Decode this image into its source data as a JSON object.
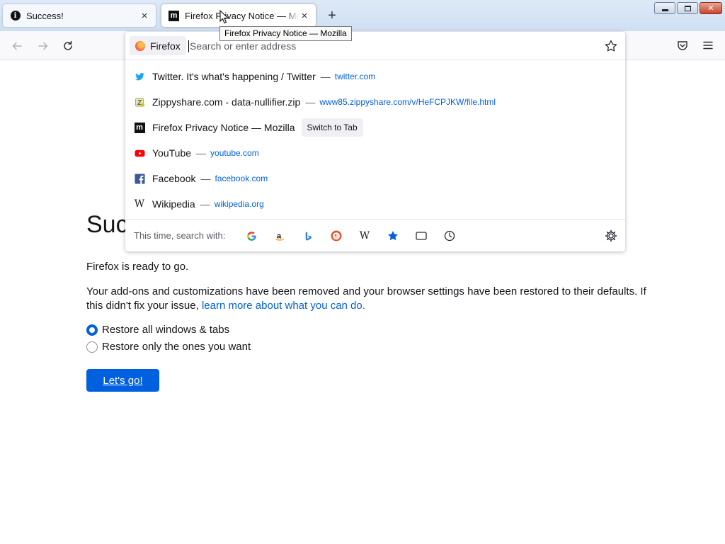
{
  "tabs": [
    {
      "title": "Success!",
      "icon": "info-icon",
      "close_label": "×"
    },
    {
      "title": "Firefox Privacy Notice — Mozilla",
      "icon": "mozilla-m-icon",
      "close_label": "×"
    }
  ],
  "new_tab_label": "+",
  "tooltip": "Firefox Privacy Notice — Mozilla",
  "urlbar": {
    "identity_label": "Firefox",
    "placeholder": "Search or enter address",
    "value": ""
  },
  "results": [
    {
      "title": "Twitter. It's what's happening / Twitter",
      "sep": "—",
      "url": "twitter.com",
      "icon": "twitter-icon"
    },
    {
      "title": "Zippyshare.com - data-nullifier.zip",
      "sep": "—",
      "url": "www85.zippyshare.com/v/HeFCPJKW/file.html",
      "icon": "zippyshare-icon"
    },
    {
      "title": "Firefox Privacy Notice — Mozilla",
      "action": "Switch to Tab",
      "icon": "mozilla-m-icon"
    },
    {
      "title": "YouTube",
      "sep": "—",
      "url": "youtube.com",
      "icon": "youtube-icon"
    },
    {
      "title": "Facebook",
      "sep": "—",
      "url": "facebook.com",
      "icon": "facebook-icon"
    },
    {
      "title": "Wikipedia",
      "sep": "—",
      "url": "wikipedia.org",
      "icon": "wikipedia-icon"
    }
  ],
  "oneoff": {
    "label": "This time, search with:",
    "engines": [
      "google-icon",
      "amazon-icon",
      "bing-icon",
      "duckduckgo-icon",
      "wikipedia-icon",
      "bookmarks-icon",
      "tabs-icon",
      "history-icon"
    ]
  },
  "page": {
    "heading": "Success!",
    "ready_text": "Firefox is ready to go.",
    "body_text": "Your add-ons and customizations have been removed and your browser settings have been restored to their defaults. If this didn't fix your issue, ",
    "link_text": "learn more about what you can do.",
    "option_all": "Restore all windows & tabs",
    "option_some": "Restore only the ones you want",
    "button_label": "Let's go!"
  },
  "colors": {
    "accent": "#0060df",
    "url_blue": "#0060df"
  }
}
